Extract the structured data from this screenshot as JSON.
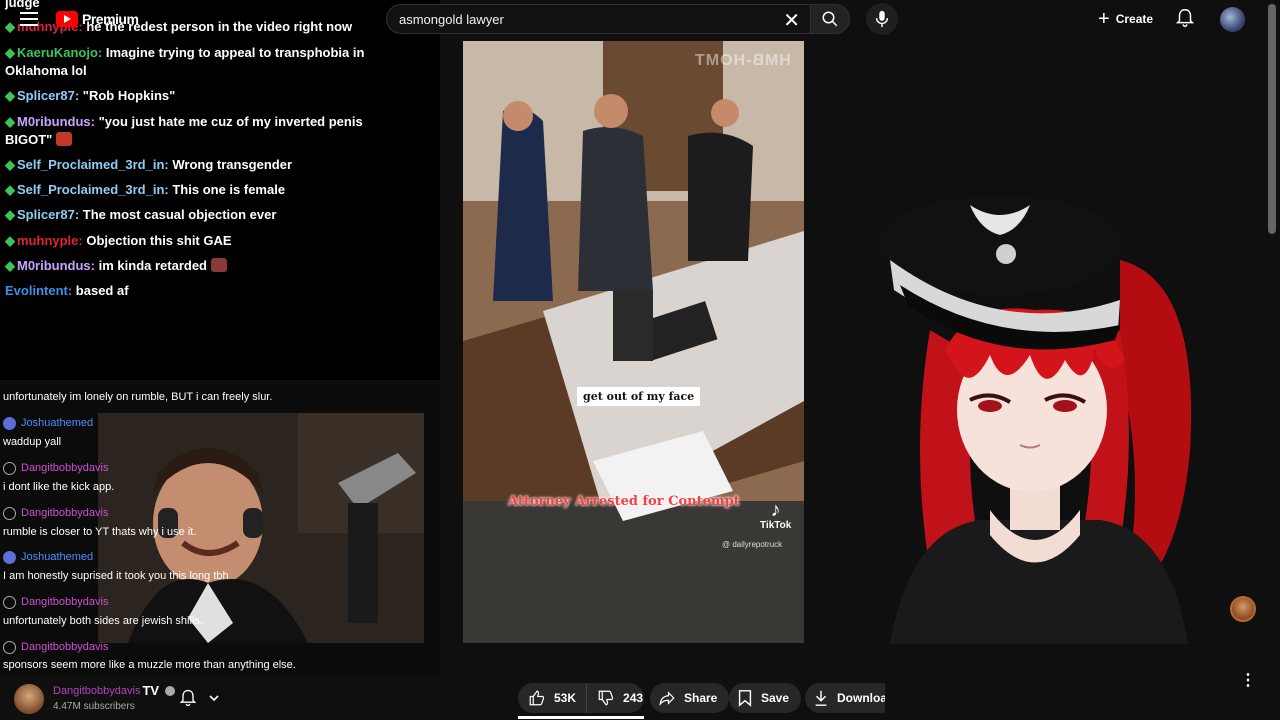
{
  "overlay": {
    "title_fragment": "judge",
    "chat": [
      {
        "user": "muhnyple:",
        "color": "#e0213a",
        "text": "he the redest person in the video right now"
      },
      {
        "user": "KaeruKanojo:",
        "color": "#3ec35a",
        "text": "Imagine trying to appeal to transphobia in",
        "text2": "Oklahoma lol"
      },
      {
        "user": "Splicer87:",
        "color": "#8ecdf5",
        "text": "\"Rob Hopkins\""
      },
      {
        "user": "M0ribundus:",
        "color": "#c8a2ff",
        "text": "\"you just hate me cuz of my inverted penis",
        "text2": "BIGOT\""
      },
      {
        "user": "Self_Proclaimed_3rd_in:",
        "color": "#8ecdf5",
        "text": "Wrong transgender"
      },
      {
        "user": "Self_Proclaimed_3rd_in:",
        "color": "#8ecdf5",
        "text": "This one is female"
      },
      {
        "user": "Splicer87:",
        "color": "#8ecdf5",
        "text": "The most casual objection ever"
      },
      {
        "user": "muhnyple:",
        "color": "#e0213a",
        "text": "Objection this shit GAE"
      },
      {
        "user": "M0ribundus:",
        "color": "#c8a2ff",
        "text": "im kinda retarded"
      },
      {
        "user": "Evolintent:",
        "color": "#3d8fe6",
        "text": "based af"
      }
    ]
  },
  "header": {
    "logo_text": "Premium",
    "search_value": "asmongold lawyer",
    "create_label": "Create"
  },
  "stream_chat": {
    "top_line": "unfortunately im lonely on rumble, BUT i can freely slur.",
    "items": [
      {
        "user": "Joshuathemed",
        "user_color": "#4a8cff",
        "ring": "blue",
        "text": "waddup yall"
      },
      {
        "user": "Dangitbobbydavis",
        "user_color": "#d04ed6",
        "ring": "plain",
        "text": "i dont like the kick app."
      },
      {
        "user": "Dangitbobbydavis",
        "user_color": "#d04ed6",
        "ring": "plain",
        "text": "rumble is closer to YT thats why i use it."
      },
      {
        "user": "Joshuathemed",
        "user_color": "#4a8cff",
        "ring": "blue",
        "text": "I am honestly suprised it took you this long tbh"
      },
      {
        "user": "Dangitbobbydavis",
        "user_color": "#d04ed6",
        "ring": "plain",
        "text": "unfortunately both sides are jewish shills."
      },
      {
        "user": "Dangitbobbydavis",
        "user_color": "#d04ed6",
        "ring": "plain",
        "text": "sponsors seem more like a muzzle more than anything else."
      }
    ]
  },
  "video": {
    "caption_face": "get out of my face",
    "caption_title": "Attorney Arrested for Contempt",
    "tiktok": "TikTok",
    "tiktok_handle": "@ dailyrepotruck",
    "watermark": "HMB-HOMT"
  },
  "channel": {
    "name": "TV",
    "name_prefix": "Dangitbobbydavis",
    "subscribers": "4.47M subscribers"
  },
  "actions": {
    "likes": "53K",
    "dislikes": "243",
    "share": "Share",
    "save": "Save",
    "download": "Download"
  }
}
